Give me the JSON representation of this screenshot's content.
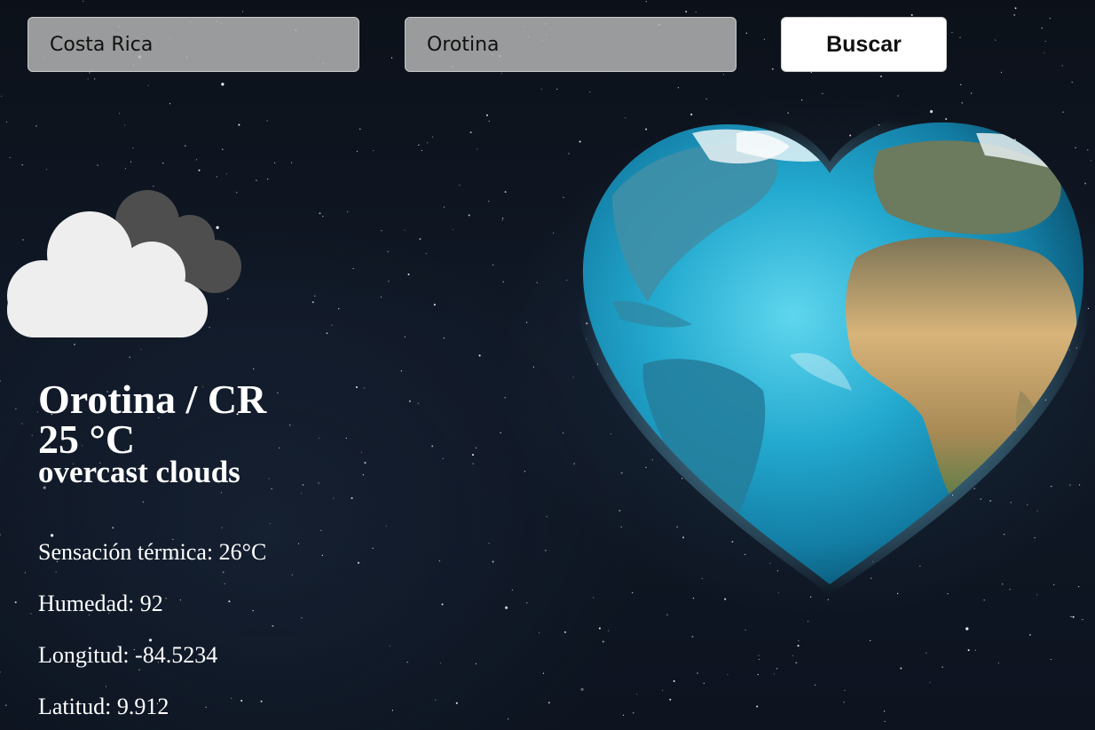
{
  "search": {
    "country_value": "Costa Rica",
    "city_value": "Orotina",
    "button_label": "Buscar"
  },
  "weather": {
    "location": "Orotina / CR",
    "temperature": "25 °C",
    "description": "overcast clouds",
    "icon": "overcast-clouds-icon"
  },
  "details": {
    "feels_like": "Sensación térmica: 26°C",
    "humidity": "Humedad: 92",
    "longitude": "Longitud: -84.5234",
    "latitude": "Latitud: 9.912"
  },
  "background": {
    "image": "heart-shaped-earth-in-starry-space",
    "space_color": "#0e1520",
    "ocean_color": "#2bb8d8",
    "land_color": "#c9a76e"
  }
}
